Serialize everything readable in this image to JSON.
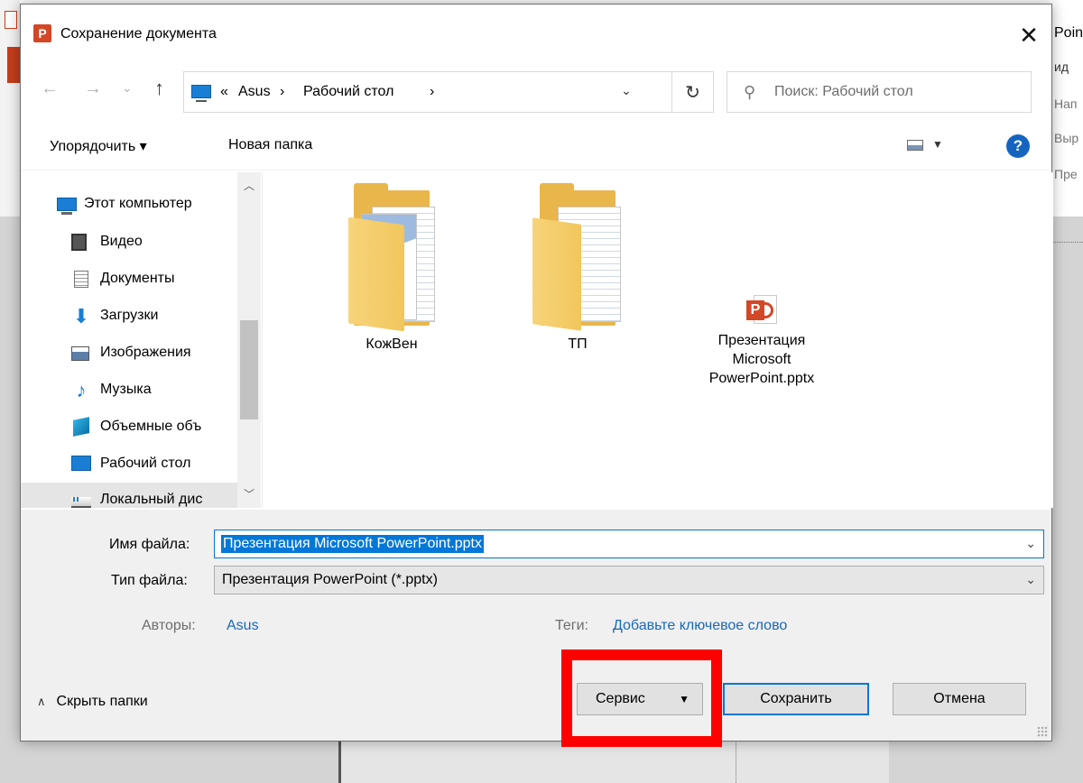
{
  "background": {
    "right_fragments": [
      "Poin",
      "ид",
      "Нап",
      "Выр",
      "Пре"
    ]
  },
  "dialog": {
    "title": "Сохранение документа",
    "app_icon_letter": "P",
    "close_glyph": "✕"
  },
  "nav": {
    "back_glyph": "←",
    "forward_glyph": "→",
    "recent_glyph": "⌄",
    "up_glyph": "↑",
    "address": {
      "overflow": "«",
      "segments": [
        "Asus",
        "Рабочий стол"
      ],
      "separator": "›"
    },
    "dropdown_glyph": "⌄",
    "refresh_glyph": "↻",
    "search_placeholder": "Поиск: Рабочий стол",
    "search_glyph": "⚲"
  },
  "toolbar": {
    "organize_label": "Упорядочить ▾",
    "new_folder_label": "Новая папка",
    "view_dd_glyph": "▼",
    "help_glyph": "?"
  },
  "navpane": {
    "items": [
      {
        "label": "Этот компьютер",
        "icon": "computer-icon"
      },
      {
        "label": "Видео",
        "icon": "video-icon"
      },
      {
        "label": "Документы",
        "icon": "documents-icon"
      },
      {
        "label": "Загрузки",
        "icon": "downloads-icon"
      },
      {
        "label": "Изображения",
        "icon": "pictures-icon"
      },
      {
        "label": "Музыка",
        "icon": "music-icon"
      },
      {
        "label": "Объемные объ",
        "icon": "3d-objects-icon"
      },
      {
        "label": "Рабочий стол",
        "icon": "desktop-icon"
      },
      {
        "label": "Локальный дис",
        "icon": "local-disk-icon"
      }
    ],
    "scroll_up_glyph": "︿",
    "scroll_down_glyph": "﹀"
  },
  "files": [
    {
      "name": "КожВен",
      "type": "folder"
    },
    {
      "name": "ТП",
      "type": "folder"
    },
    {
      "name": "Презентация Microsoft PowerPoint.pptx",
      "type": "pptx",
      "lines": [
        "Презентация",
        "Microsoft",
        "PowerPoint.pptx"
      ]
    }
  ],
  "form": {
    "filename_label": "Имя файла:",
    "filename_value": "Презентация Microsoft PowerPoint.pptx",
    "filetype_label": "Тип файла:",
    "filetype_value": "Презентация PowerPoint (*.pptx)",
    "authors_label": "Авторы:",
    "authors_value": "Asus",
    "tags_label": "Теги:",
    "tags_value": "Добавьте ключевое слово",
    "chevron_glyph": "⌄"
  },
  "footer": {
    "hide_folders_label": "Скрыть папки",
    "hide_folders_glyph": "∧",
    "service_label": "Сервис",
    "service_dd_glyph": "▼",
    "save_label": "Сохранить",
    "cancel_label": "Отмена"
  },
  "colors": {
    "accent": "#0078d7",
    "highlight": "#ff0000",
    "powerpoint": "#d24726",
    "link": "#1a68b8"
  }
}
